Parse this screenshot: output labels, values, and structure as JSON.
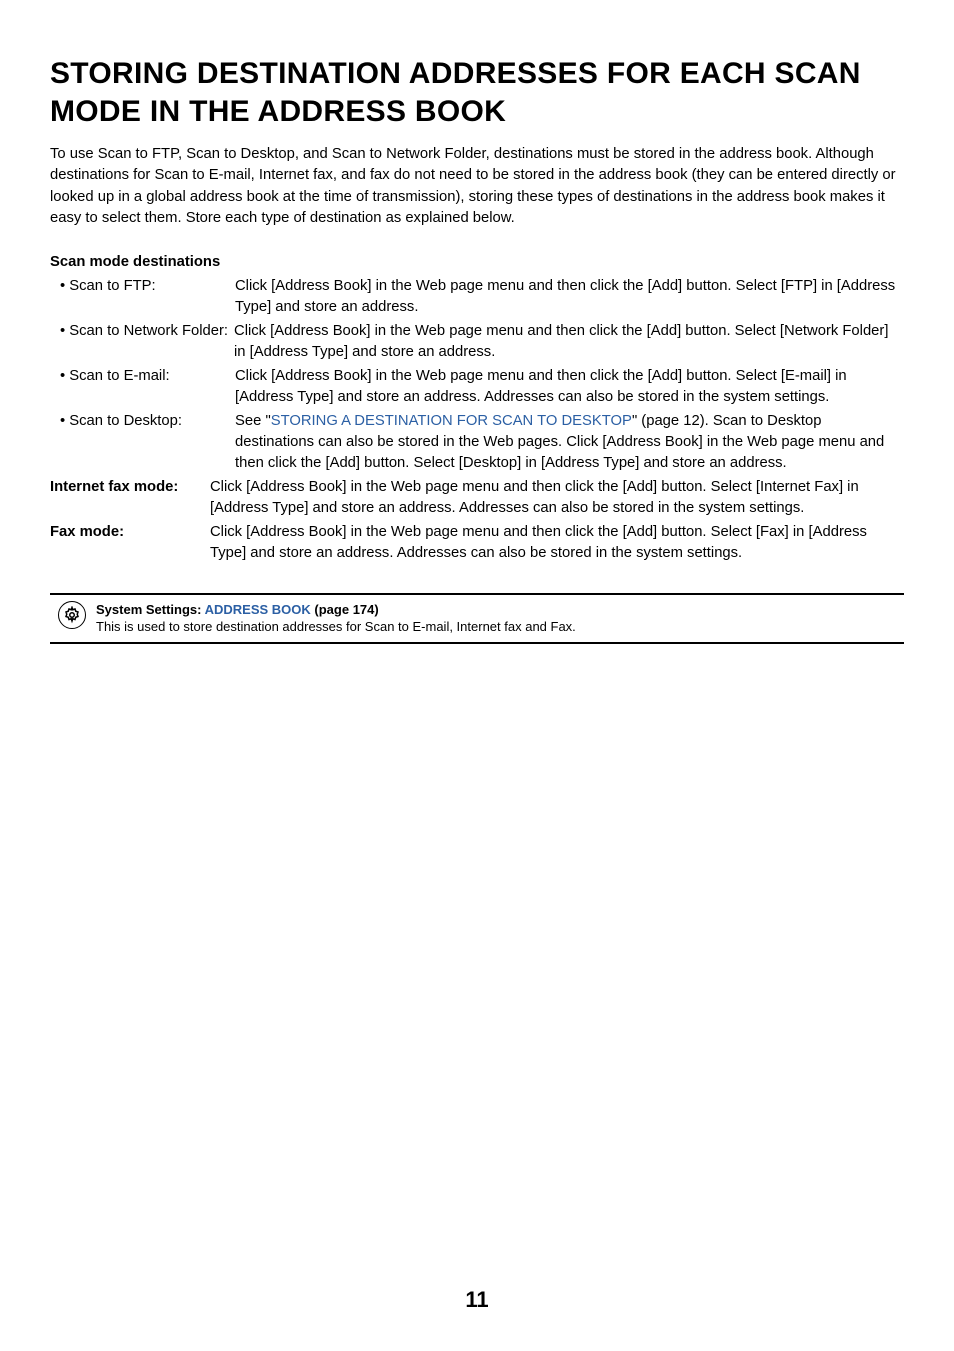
{
  "heading": "STORING DESTINATION ADDRESSES FOR EACH SCAN MODE IN THE ADDRESS BOOK",
  "intro": "To use Scan to FTP, Scan to Desktop, and Scan to Network Folder, destinations must be stored in the address book. Although destinations for Scan to E-mail, Internet fax, and fax do not need to be stored in the address book (they can be entered directly or looked up in a global address book at the time of transmission), storing these types of destinations in the address book makes it easy to select them. Store each type of destination as explained below.",
  "subhead": "Scan mode destinations",
  "rows": {
    "r0": {
      "label": "• Scan to FTP:",
      "desc": "Click [Address Book] in the Web page menu and then click the [Add] button. Select [FTP] in [Address Type] and store an address."
    },
    "r1": {
      "label": "• Scan to Network Folder:",
      "desc": "Click [Address Book] in the Web page menu and then click the [Add] button. Select [Network Folder] in [Address Type] and store an address."
    },
    "r2": {
      "label": "• Scan to E-mail:",
      "desc": "Click [Address Book] in the Web page menu and then click the [Add] button. Select [E-mail] in [Address Type] and store an address. Addresses can also be stored in the system settings."
    },
    "r3": {
      "label": "• Scan to Desktop:",
      "before": "See \"",
      "link": "STORING A DESTINATION FOR SCAN TO DESKTOP",
      "after": "\" (page 12). Scan to Desktop destinations can also be stored in the Web pages. Click [Address Book] in the Web page menu and then click the [Add] button. Select [Desktop] in [Address Type] and store an address."
    },
    "r4": {
      "label": "Internet fax mode:",
      "desc": "Click [Address Book] in the Web page menu and then click the [Add] button. Select [Internet Fax] in [Address Type] and store an address. Addresses can also be stored in the system settings."
    },
    "r5": {
      "label": "Fax mode:",
      "desc": "Click [Address Book] in the Web page menu and then click the [Add] button. Select [Fax] in [Address Type] and store an address. Addresses can also be stored in the system settings."
    }
  },
  "note": {
    "title_prefix": "System Settings: ",
    "title_link": "ADDRESS BOOK",
    "title_suffix": " (page 174)",
    "body": "This is used to store destination addresses for Scan to E-mail, Internet fax and Fax."
  },
  "page_number": "11"
}
